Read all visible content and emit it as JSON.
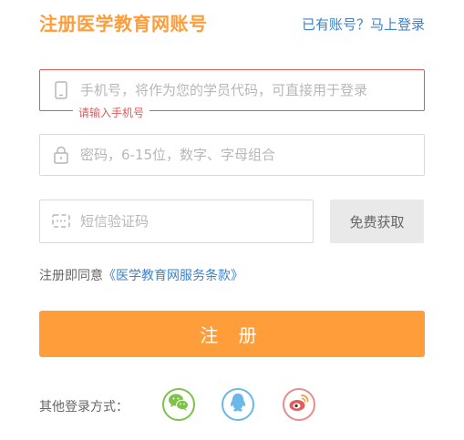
{
  "header": {
    "title": "注册医学教育网账号",
    "login_link": "已有账号？马上登录"
  },
  "form": {
    "phone": {
      "placeholder": "手机号，将作为您的学员代码，可直接用于登录",
      "value": "",
      "error": "请输入手机号"
    },
    "password": {
      "placeholder": "密码，6-15位，数字、字母组合",
      "value": ""
    },
    "sms": {
      "placeholder": "短信验证码",
      "value": "",
      "button_label": "免费获取"
    },
    "agreement": {
      "prefix": "注册即同意",
      "link": "《医学教育网服务条款》"
    },
    "submit_label": "注 册"
  },
  "social": {
    "label": "其他登录方式：",
    "items": [
      {
        "name": "wechat",
        "icon": "wechat-icon",
        "color": "#7ec24a"
      },
      {
        "name": "qq",
        "icon": "qq-icon",
        "color": "#6ab8e8"
      },
      {
        "name": "weibo",
        "icon": "weibo-icon",
        "color": "#e98b8b"
      }
    ]
  },
  "colors": {
    "accent": "#ff9d3b",
    "link": "#3d82c8",
    "error": "#e05a5a"
  }
}
